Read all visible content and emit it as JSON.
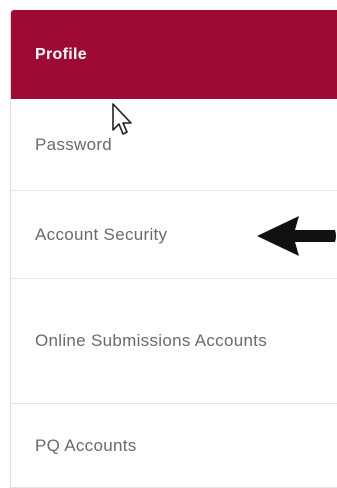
{
  "nav": {
    "items": [
      {
        "label": "Profile",
        "active": true
      },
      {
        "label": "Password",
        "active": false
      },
      {
        "label": "Account Security",
        "active": false
      },
      {
        "label": "Online Submissions Accounts",
        "active": false
      },
      {
        "label": "PQ Accounts",
        "active": false
      }
    ]
  },
  "colors": {
    "active_background": "#9d0a33",
    "active_text": "#ffffff",
    "item_text": "#6a6a6a",
    "divider": "#e6e6e6"
  },
  "overlays": {
    "cursor_icon": "mouse-pointer-icon",
    "annotation_icon": "left-arrow-icon"
  }
}
